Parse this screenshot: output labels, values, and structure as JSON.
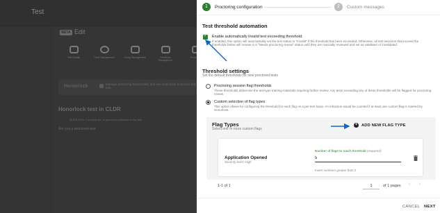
{
  "background": {
    "app_title": "Test",
    "badge": "BETA",
    "edit_label": "Edit",
    "tiles": [
      "Test Details",
      "Timer Management",
      "Group Management",
      "Feedback Management",
      "Proctoring"
    ],
    "panel_title": "Honorlock",
    "panel_text": "Manage proctoring functionality and use Honorlock to proctor this test.",
    "section_title": "Honorlock test in CLDR",
    "warning": "QUESTION: Complete list of questions available in the test",
    "row_text": "Are you a proctored test"
  },
  "stepper": {
    "steps": [
      {
        "number": "1",
        "label": "Proctoring configuration"
      },
      {
        "number": "2",
        "label": "Custom messages"
      }
    ],
    "active_color": "#2e7d32",
    "inactive_color": "#bdbdbd"
  },
  "automation": {
    "title": "Test threshold automation",
    "checkbox_label": "Enable automatically invalid test exceeding threshold",
    "checkbox_desc": "If enabled, this option will automatically set the test status to \"Invalid\" if the threshold has been exceeded. Otherwise, all test sessions that exceed the thresholds below will remain in a \"Needs proctoring review\" status until they are manually reviewed and set as validated or invalidated."
  },
  "threshold": {
    "title": "Threshold settings",
    "subtitle": "Set the default thresholds for new proctored tests",
    "options": [
      {
        "label": "Proctoring session flag thresholds",
        "desc": "These thresholds determine the test-type training materials requiring further review. Any tests exceeding any of these thresholds will be flagged for proctoring review."
      },
      {
        "label": "Custom selection of flag types",
        "desc": "This option allows for configuring the threshold for each flag on a per-test basis. An infraction would be counted if at least one custom flag is marked by Honorlock."
      }
    ]
  },
  "flags": {
    "title": "Flag Types",
    "subtitle": "Select one or more custom flags",
    "add_button": "ADD NEW FLAG TYPE",
    "card": {
      "name": "Application Opened",
      "severity": "Severity level: High",
      "field_label": "Number of flags to reach threshold",
      "required_label": "(required)",
      "value": "5",
      "help": "Insert numbers greater than 0"
    }
  },
  "pagination": {
    "range": "1-1 of 1",
    "page": "1",
    "of_pages": "of 1 pages",
    "prev": "‹",
    "next": "›"
  },
  "footer": {
    "cancel": "CANCEL",
    "next": "NEXT"
  },
  "colors": {
    "accent": "#2e7d32",
    "arrow": "#1565c0"
  }
}
